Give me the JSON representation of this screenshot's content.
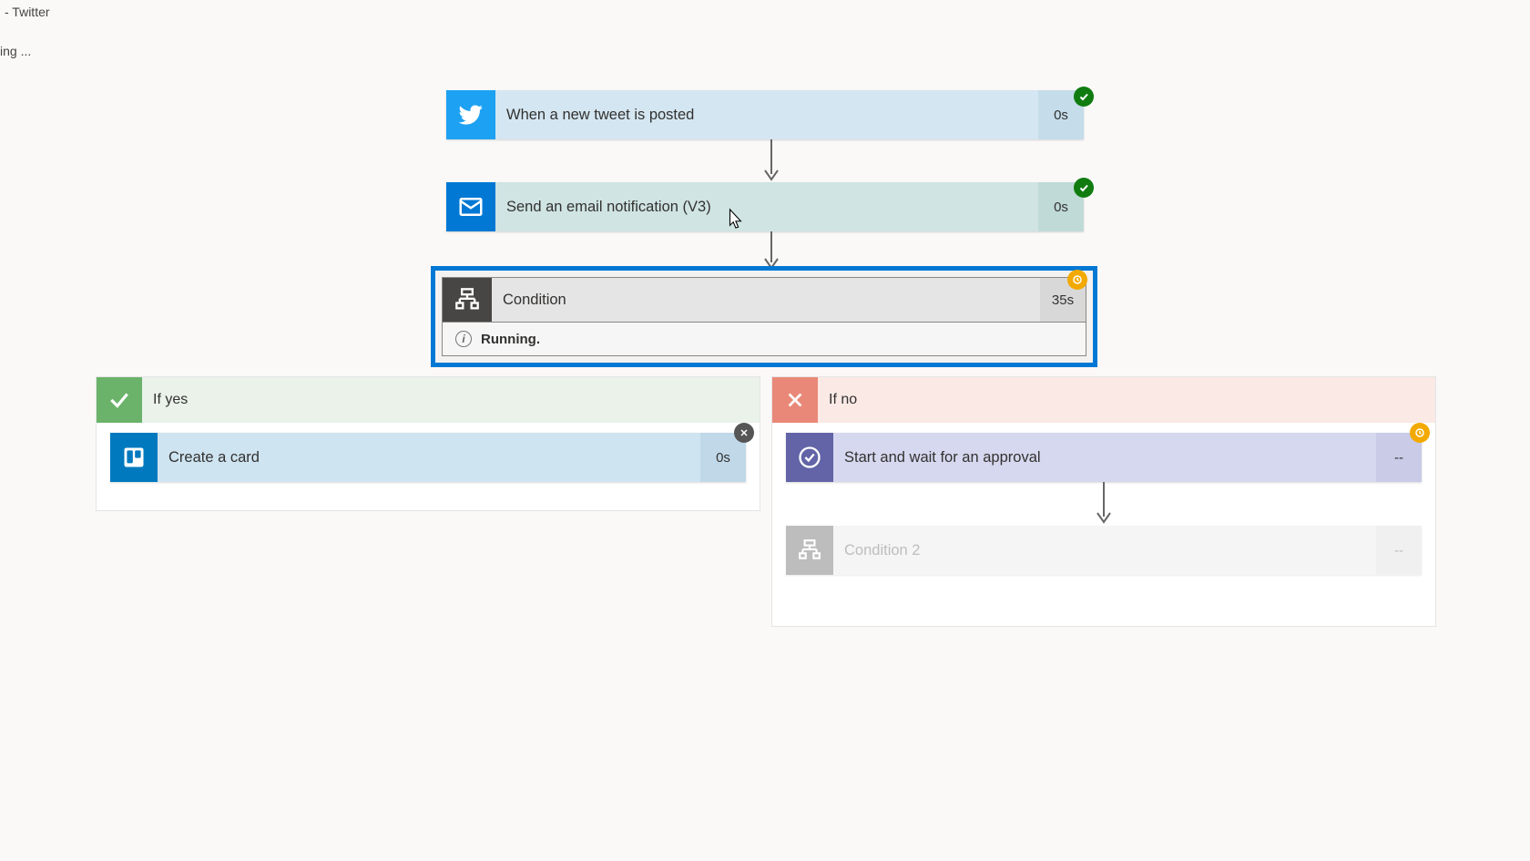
{
  "window": {
    "tab_suffix": "- Twitter",
    "loading_text": "ing ..."
  },
  "flow": {
    "trigger": {
      "label": "When a new tweet is posted",
      "duration": "0s",
      "status": "success"
    },
    "email": {
      "label": "Send an email notification (V3)",
      "duration": "0s",
      "status": "success"
    },
    "condition": {
      "label": "Condition",
      "duration": "35s",
      "status": "pending",
      "running_text": "Running."
    },
    "branch_yes": {
      "header": "If yes",
      "card": {
        "label": "Create a card",
        "duration": "0s",
        "status": "cancelled"
      }
    },
    "branch_no": {
      "header": "If no",
      "approval": {
        "label": "Start and wait for an approval",
        "duration": "--",
        "status": "pending"
      },
      "condition2": {
        "label": "Condition 2",
        "duration": "--"
      }
    }
  }
}
